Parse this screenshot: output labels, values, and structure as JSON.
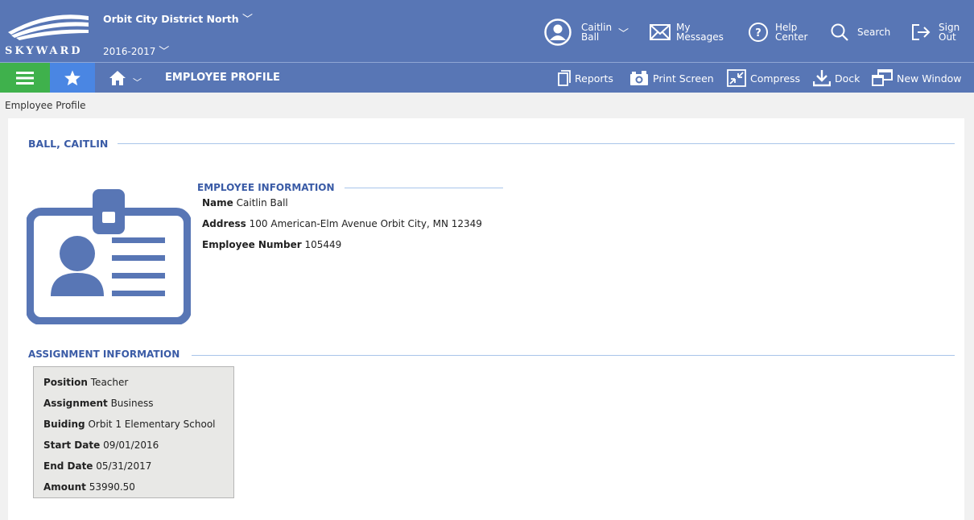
{
  "header": {
    "logo_text": "SKYWARD",
    "district": "Orbit City District North",
    "year": "2016-2017"
  },
  "user_menu": [
    {
      "line1": "Caitlin",
      "line2": "Ball",
      "icon": "avatar-icon"
    },
    {
      "line1": "My",
      "line2": "Messages",
      "icon": "envelope-icon"
    },
    {
      "line1": "Help",
      "line2": "Center",
      "icon": "help-icon"
    },
    {
      "line1": "Search",
      "icon": "search-icon"
    },
    {
      "line1": "Sign",
      "line2": "Out",
      "icon": "sign-out-icon"
    }
  ],
  "nav": {
    "title": "EMPLOYEE PROFILE",
    "tools": [
      "Reports",
      "Print Screen",
      "Compress",
      "Dock",
      "New Window"
    ]
  },
  "breadcrumb": "Employee Profile",
  "employee": {
    "heading": "BALL, CAITLIN",
    "info_heading": "EMPLOYEE INFORMATION",
    "name_label": "Name",
    "name": "Caitlin Ball",
    "address_label": "Address",
    "address": "100 American-Elm Avenue Orbit City, MN 12349",
    "number_label": "Employee Number",
    "number": "105449"
  },
  "assignment": {
    "heading": "ASSIGNMENT INFORMATION",
    "rows": [
      {
        "label": "Position",
        "value": "Teacher"
      },
      {
        "label": "Assignment",
        "value": "Business"
      },
      {
        "label": "Buiding",
        "value": "Orbit 1 Elementary School"
      },
      {
        "label": "Start Date",
        "value": "09/01/2016"
      },
      {
        "label": "End Date",
        "value": "05/31/2017"
      },
      {
        "label": "Amount",
        "value": "53990.50"
      }
    ]
  },
  "colors": {
    "header_bg": "#5876b5",
    "menu_green": "#3fb14c",
    "star_blue": "#4a86e3",
    "section_blue": "#3a5ba6",
    "id_card_blue": "#5876b5"
  }
}
